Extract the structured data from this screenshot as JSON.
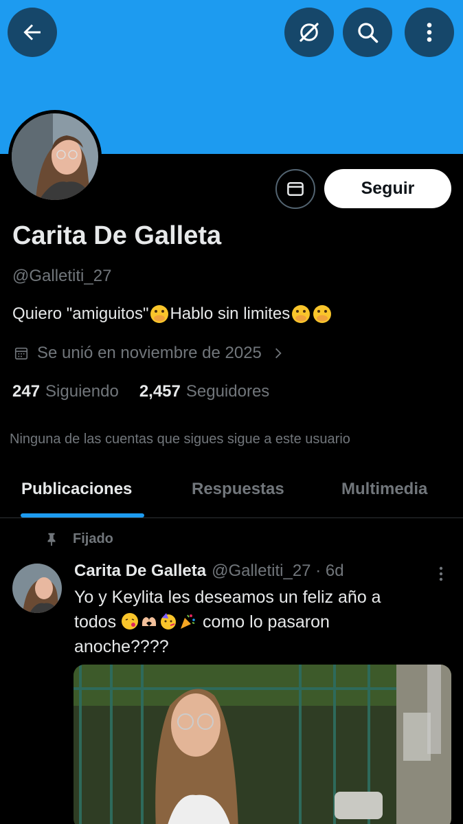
{
  "header": {
    "back_icon": "arrow-left-icon",
    "grok_icon": "grok-icon",
    "search_icon": "search-icon",
    "more_icon": "more-vertical-icon"
  },
  "profile": {
    "name": "Carita De Galleta",
    "handle": "@Galletiti_27",
    "bio": "Quiero \"amiguitos\"",
    "bio_part2": " Hablo sin limites",
    "joined": "Se unió en noviembre de 2025",
    "following_count": "247",
    "following_label": "Siguiendo",
    "followers_count": "2,457",
    "followers_label": "Seguidores",
    "no_mutuals": "Ninguna de las cuentas que sigues sigue a este usuario",
    "follow_label": "Seguir"
  },
  "tabs": [
    {
      "label": "Publicaciones",
      "active": true
    },
    {
      "label": "Respuestas",
      "active": false
    },
    {
      "label": "Multimedia",
      "active": false
    }
  ],
  "post": {
    "pinned_label": "Fijado",
    "author": "Carita De Galleta",
    "meta": "@Galletiti_27 · 6d",
    "line1": "Yo y Keylita les deseamos un feliz año a",
    "line2_start": "todos ",
    "line2_end": " como lo pasaron",
    "line3": "anoche????"
  },
  "colors": {
    "banner": "#1d9bf0",
    "accent": "#1d9bf0",
    "background": "#000000",
    "text": "#e7e9ea",
    "muted": "#71767b"
  }
}
